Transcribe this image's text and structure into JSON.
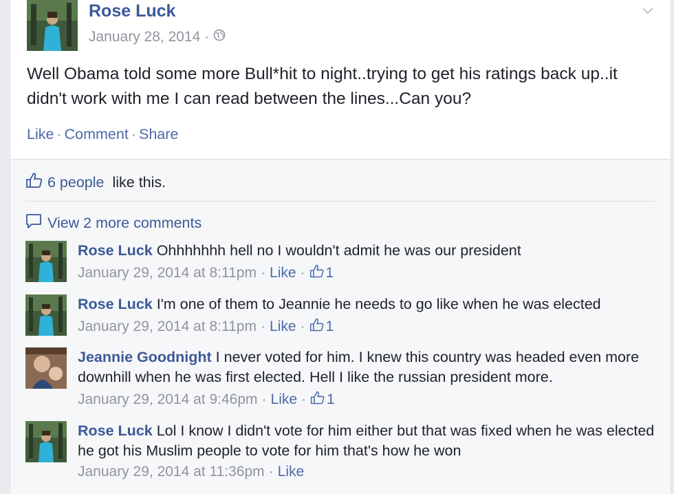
{
  "post": {
    "author": "Rose Luck",
    "date": "January 28, 2014",
    "separator": "·",
    "text": "Well Obama told some more Bull*hit to night..trying to get his ratings back up..it didn't work with me I can read between the lines...Can you?",
    "actions": [
      "Like",
      "Comment",
      "Share"
    ]
  },
  "likes": {
    "people": "6 people",
    "suffix": " like this."
  },
  "view_more": "View 2 more comments",
  "comments": [
    {
      "author": "Rose Luck",
      "text": " Ohhhhhhh hell no I wouldn't admit he was our president",
      "date": "January 29, 2014 at 8:11pm",
      "like": "Like",
      "count": "1",
      "avatar": "rose"
    },
    {
      "author": "Rose Luck",
      "text": " I'm one of them to Jeannie he needs to go like when he was elected",
      "date": "January 29, 2014 at 8:11pm",
      "like": "Like",
      "count": "1",
      "avatar": "rose"
    },
    {
      "author": "Jeannie Goodnight",
      "text": " I never voted for him. I knew this country was headed even more downhill when he was first elected. Hell I like the russian president more.",
      "date": "January 29, 2014 at 9:46pm",
      "like": "Like",
      "count": "1",
      "avatar": "jeannie"
    },
    {
      "author": "Rose Luck",
      "text": " Lol I know I didn't vote for him either but that was fixed when he was elected he got his Muslim people to vote for him that's how he won",
      "date": "January 29, 2014 at 11:36pm",
      "like": "Like",
      "count": "",
      "avatar": "rose"
    }
  ],
  "colors": {
    "link": "#3b5998",
    "meta": "#90949c",
    "background": "#f6f7f9"
  },
  "icons": [
    "globe-icon",
    "chevron-down-icon",
    "thumbs-up-icon",
    "comment-bubble-icon"
  ]
}
